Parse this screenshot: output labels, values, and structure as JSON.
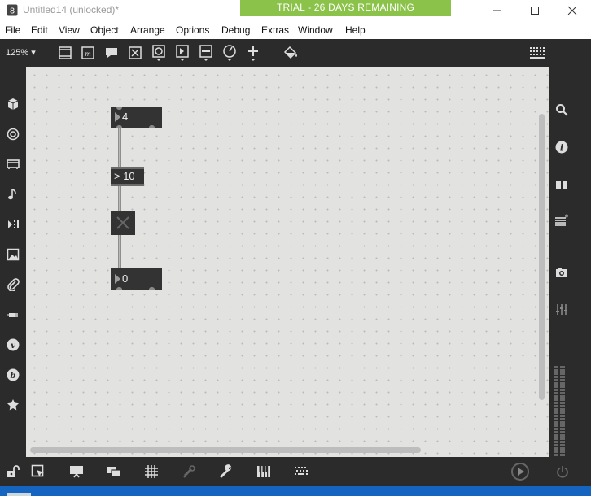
{
  "window": {
    "title": "Untitled14 (unlocked)*",
    "trial_banner": "TRIAL - 26 DAYS REMAINING",
    "controls": [
      "minimize-icon",
      "maximize-icon",
      "close-icon"
    ]
  },
  "menu": {
    "items": [
      "File",
      "Edit",
      "View",
      "Object",
      "Arrange",
      "Options",
      "Debug",
      "Extras",
      "Window",
      "Help"
    ]
  },
  "toolbar": {
    "zoom": "125% ▾",
    "icons": [
      "presentation-icon",
      "message-box-icon",
      "comment-icon",
      "toggle-object-icon",
      "button-object-icon",
      "number-box-icon",
      "slider-icon",
      "dial-icon",
      "add-object-icon",
      "paint-bucket-icon",
      "grid-keypad-icon"
    ]
  },
  "left_sidebar": {
    "icons": [
      "package-icon",
      "target-icon",
      "patcher-icon",
      "music-note-icon",
      "signal-flow-icon",
      "image-icon",
      "clip-icon",
      "plug-icon",
      "vimeo-icon",
      "bpatcher-icon",
      "star-icon"
    ]
  },
  "right_sidebar": {
    "icons": [
      "search-icon",
      "info-icon",
      "reference-book-icon",
      "max-console-icon",
      "snapshot-camera-icon",
      "mixer-icon"
    ]
  },
  "patch": {
    "number_top": "4",
    "comparison": "> 10",
    "number_bottom": "0"
  },
  "bottombar": {
    "icons": [
      "lock-icon",
      "select-arrow-icon",
      "presentation-mode-icon",
      "layers-icon",
      "grid-icon",
      "patch-cords-icon",
      "wrench-icon",
      "keyboard-icon",
      "dots-keypad-icon",
      "audio-on-icon",
      "power-icon"
    ]
  },
  "colors": {
    "trial_banner": "#8bc34a",
    "dark_ui": "#2b2b2b",
    "canvas": "#e2e3e1",
    "object": "#333333"
  }
}
